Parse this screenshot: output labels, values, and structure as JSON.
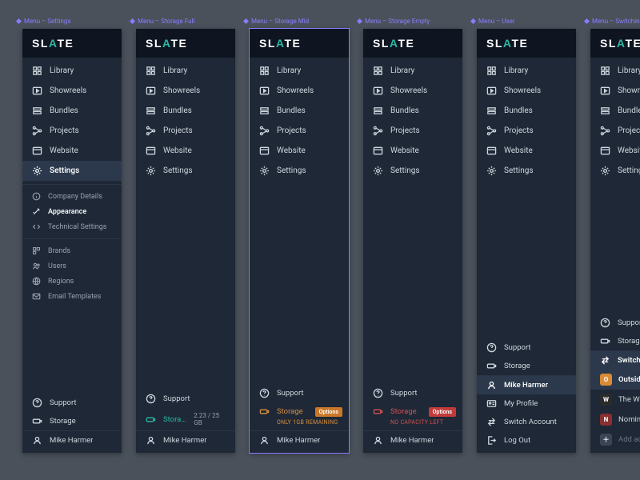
{
  "brand": {
    "text": "SLATE",
    "accent_index": 2
  },
  "frames": [
    {
      "id": "settings",
      "label": "Menu – Settings"
    },
    {
      "id": "storage-full",
      "label": "Menu – Storage Full"
    },
    {
      "id": "storage-mid",
      "label": "Menu – Storage Mid",
      "selected": true
    },
    {
      "id": "storage-empty",
      "label": "Menu – Storage Empty"
    },
    {
      "id": "user",
      "label": "Menu – User"
    },
    {
      "id": "switching",
      "label": "Menu – Switching"
    }
  ],
  "nav": {
    "items": [
      {
        "key": "library",
        "label": "Library",
        "icon": "grid"
      },
      {
        "key": "showreels",
        "label": "Showreels",
        "icon": "play-rect"
      },
      {
        "key": "bundles",
        "label": "Bundles",
        "icon": "stack"
      },
      {
        "key": "projects",
        "label": "Projects",
        "icon": "nodes"
      },
      {
        "key": "website",
        "label": "Website",
        "icon": "window"
      },
      {
        "key": "settings",
        "label": "Settings",
        "icon": "gear"
      }
    ],
    "settings_subgroups": [
      [
        {
          "key": "company-details",
          "label": "Company Details",
          "icon": "info"
        },
        {
          "key": "appearance",
          "label": "Appearance",
          "icon": "wand",
          "active": true
        },
        {
          "key": "technical-settings",
          "label": "Technical Settings",
          "icon": "code"
        }
      ],
      [
        {
          "key": "brands",
          "label": "Brands",
          "icon": "tag-grid"
        },
        {
          "key": "users",
          "label": "Users",
          "icon": "users"
        },
        {
          "key": "regions",
          "label": "Regions",
          "icon": "globe"
        },
        {
          "key": "email-templates",
          "label": "Email Templates",
          "icon": "mail"
        }
      ]
    ]
  },
  "footer": {
    "support": {
      "label": "Support",
      "icon": "help"
    },
    "storage": {
      "label": "Storage",
      "icon": "battery",
      "full": {
        "value": "2.23 / 25 GB"
      },
      "mid": {
        "note": "ONLY 1GB REMAINING",
        "chip": "Options"
      },
      "empty": {
        "note": "NO CAPACITY LEFT",
        "chip": "Options"
      }
    },
    "user": {
      "name": "Mike Harmer",
      "icon": "user"
    },
    "user_menu": [
      {
        "key": "my-profile",
        "label": "My Profile",
        "icon": "id-card"
      },
      {
        "key": "switch-account",
        "label": "Switch Account",
        "icon": "swap"
      },
      {
        "key": "log-out",
        "label": "Log Out",
        "icon": "logout"
      }
    ],
    "switch_header": {
      "label": "Switch Account",
      "icon": "swap"
    },
    "accounts": [
      {
        "key": "outsider",
        "label": "Outsider",
        "avatar_bg": "#d98b35",
        "initial": "O",
        "active": true
      },
      {
        "key": "workshop",
        "label": "The Workshop",
        "avatar_bg": "#2b2b2b",
        "initial": "W"
      },
      {
        "key": "nomint",
        "label": "Nomint",
        "avatar_bg": "#8a2f2f",
        "initial": "N"
      }
    ],
    "add_account": {
      "label": "Add account",
      "icon": "plus"
    }
  }
}
